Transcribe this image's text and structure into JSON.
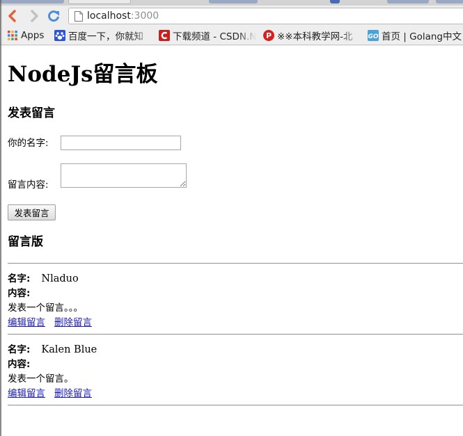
{
  "browser": {
    "url_host": "localhost",
    "url_port": ":3000",
    "bookmarks": [
      {
        "label": "Apps",
        "icon": "apps-grid-icon"
      },
      {
        "label": "百度一下，你就知",
        "icon": "baidu-paw-icon"
      },
      {
        "label": "下载频道 - CSDN.N",
        "icon": "csdn-icon"
      },
      {
        "label": "※※本科教学网-北",
        "icon": "p-badge-icon"
      },
      {
        "label": "首页 | Golang中文",
        "icon": "go-icon"
      }
    ]
  },
  "page": {
    "title": "NodeJs留言板",
    "compose": {
      "heading": "发表留言",
      "name_label": "你的名字:",
      "content_label": "留言内容:",
      "name_value": "",
      "content_value": "",
      "submit_label": "发表留言"
    },
    "board": {
      "heading": "留言版",
      "name_label": "名字:",
      "content_label": "内容:",
      "edit_label": "编辑留言",
      "delete_label": "删除留言",
      "messages": [
        {
          "author": "Nladuo",
          "content": "发表一个留言。。。"
        },
        {
          "author": "Kalen Blue",
          "content": "发表一个留言。"
        }
      ]
    }
  }
}
